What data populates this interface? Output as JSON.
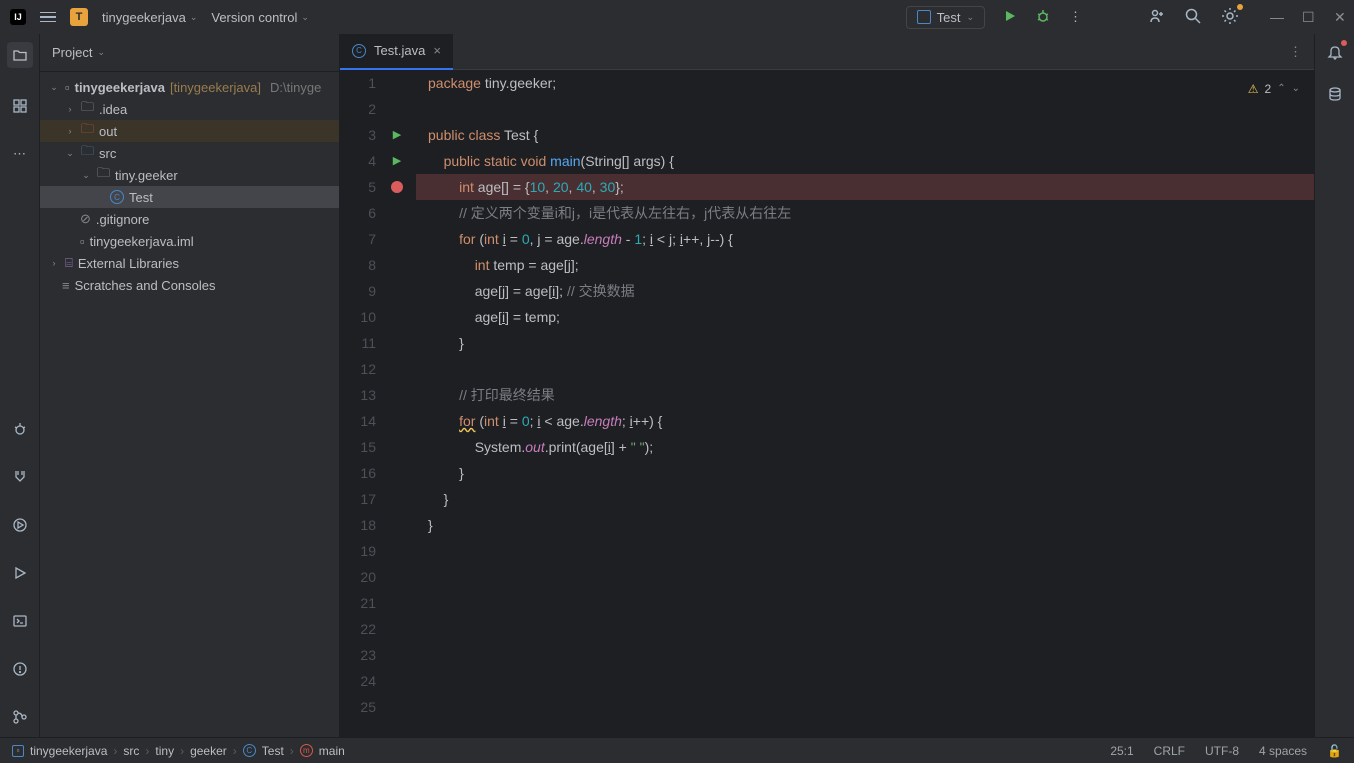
{
  "titlebar": {
    "project_name": "tinygeekerjava",
    "vcs_label": "Version control",
    "run_config": "Test"
  },
  "sidebar": {
    "title": "Project",
    "tree": {
      "root": "tinygeekerjava",
      "root_bracket": "[tinygeekerjava]",
      "root_path": "D:\\tinyge",
      "idea": ".idea",
      "out": "out",
      "src": "src",
      "pkg": "tiny.geeker",
      "cls": "Test",
      "gitignore": ".gitignore",
      "iml": "tinygeekerjava.iml",
      "ext_lib": "External Libraries",
      "scratches": "Scratches and Consoles"
    }
  },
  "tabs": {
    "active": "Test.java"
  },
  "inspections": {
    "warnings": "2"
  },
  "code": {
    "l1_a": "package",
    "l1_b": " tiny.geeker;",
    "l3_a": "public class",
    "l3_b": " Test {",
    "l4_a": "public static void",
    "l4_m": "main",
    "l4_b": "(String[] args) {",
    "l5_a": "int",
    "l5_b": " age",
    "l5_c": "[]",
    "l5_d": " = {",
    "l5_n1": "10",
    "l5_n2": "20",
    "l5_n3": "40",
    "l5_n4": "30",
    "l5_e": ", ",
    "l5_f": "};",
    "l6": "// 定义两个变量i和j，i是代表从左往右，j代表从右往左",
    "l7_a": "for",
    "l7_b": " (",
    "l7_c": "int",
    "l7_d": " ",
    "l7_i": "i",
    "l7_e": " = ",
    "l7_z": "0",
    "l7_f": ", ",
    "l7_j": "j",
    "l7_g": " = age.",
    "l7_len": "length",
    "l7_h": " - ",
    "l7_one": "1",
    "l7_k": "; ",
    "l7_i2": "i",
    "l7_l": " < ",
    "l7_j2": "j",
    "l7_m": "; ",
    "l7_i3": "i",
    "l7_n": "++, ",
    "l7_j3": "j",
    "l7_o": "--) {",
    "l8_a": "int",
    "l8_b": " temp = age[",
    "l8_j": "j",
    "l8_c": "];",
    "l9_a": "age[",
    "l9_j": "j",
    "l9_b": "] = age[",
    "l9_i": "i",
    "l9_c": "]; ",
    "l9_cmt": "// 交换数据",
    "l10_a": "age[",
    "l10_i": "i",
    "l10_b": "] = temp;",
    "l11": "}",
    "l13": "// 打印最终结果",
    "l14_a": "for",
    "l14_b": " (",
    "l14_c": "int",
    "l14_i": "i",
    "l14_d": " = ",
    "l14_z": "0",
    "l14_e": "; ",
    "l14_i2": "i",
    "l14_f": " < age.",
    "l14_len": "length",
    "l14_g": "; ",
    "l14_i3": "i",
    "l14_h": "++) {",
    "l15_a": "System.",
    "l15_out": "out",
    "l15_b": ".print(age[",
    "l15_i": "i",
    "l15_c": "] + ",
    "l15_s": "\" \"",
    "l15_d": ");",
    "l16": "}",
    "l17": "}",
    "l18": "}"
  },
  "breadcrumb": {
    "p1": "tinygeekerjava",
    "p2": "src",
    "p3": "tiny",
    "p4": "geeker",
    "p5": "Test",
    "p6": "main"
  },
  "status": {
    "pos": "25:1",
    "sep": "CRLF",
    "enc": "UTF-8",
    "indent": "4 spaces"
  },
  "line_numbers": [
    "1",
    "2",
    "3",
    "4",
    "5",
    "6",
    "7",
    "8",
    "9",
    "10",
    "11",
    "12",
    "13",
    "14",
    "15",
    "16",
    "17",
    "18",
    "19",
    "20",
    "21",
    "22",
    "23",
    "24",
    "25"
  ]
}
